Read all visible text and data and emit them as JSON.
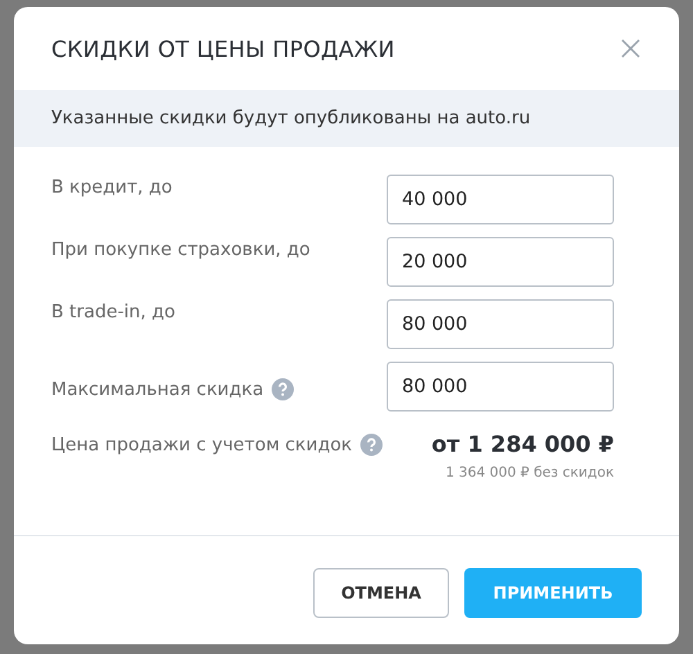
{
  "dialog": {
    "title": "СКИДКИ ОТ ЦЕНЫ ПРОДАЖИ",
    "notice": "Указанные скидки будут опубликованы на auto.ru",
    "fields": [
      {
        "label": "В кредит, до",
        "value": "40 000",
        "help": false
      },
      {
        "label": "При покупке страховки, до",
        "value": "20 000",
        "help": false
      },
      {
        "label": "В trade-in, до",
        "value": "80 000",
        "help": false
      },
      {
        "label": "Максимальная скидка",
        "value": "80 000",
        "help": true
      }
    ],
    "price": {
      "label": "Цена продажи с учетом скидок",
      "value": "от 1 284 000 ₽",
      "note": "1 364 000 ₽ без скидок"
    },
    "buttons": [
      {
        "label": "ОТМЕНА",
        "kind": "secondary"
      },
      {
        "label": "ПРИМЕНИТЬ",
        "kind": "primary"
      }
    ]
  }
}
